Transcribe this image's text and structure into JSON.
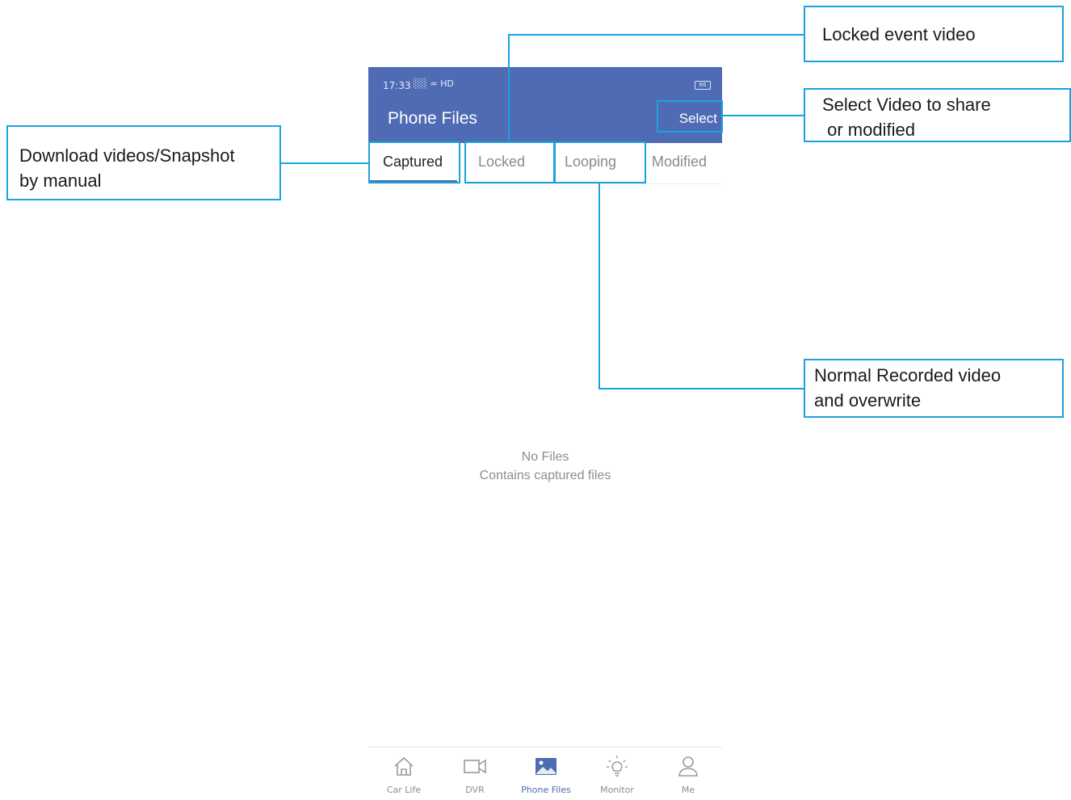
{
  "status_bar": {
    "time": "17:33",
    "icons": "░░ ≈ HD",
    "battery": "86"
  },
  "header": {
    "title": "Phone Files",
    "select_label": "Select"
  },
  "tabs": [
    {
      "label": "Captured",
      "active": true
    },
    {
      "label": "Locked",
      "active": false
    },
    {
      "label": "Looping",
      "active": false
    },
    {
      "label": "Modified",
      "active": false
    }
  ],
  "empty_state": {
    "title": "No Files",
    "subtitle": "Contains captured files"
  },
  "bottom_nav": [
    {
      "label": "Car Life",
      "icon": "home-icon",
      "active": false
    },
    {
      "label": "DVR",
      "icon": "video-camera-icon",
      "active": false
    },
    {
      "label": "Phone Files",
      "icon": "gallery-icon",
      "active": true
    },
    {
      "label": "Monitor",
      "icon": "light-bulb-icon",
      "active": false
    },
    {
      "label": "Me",
      "icon": "person-icon",
      "active": false
    }
  ],
  "annotations": {
    "captured": "Download videos/Snapshot\nby manual",
    "locked": "Locked event video",
    "select": "Select Video to share\n or modified",
    "looping": "Normal Recorded video\nand overwrite"
  },
  "colors": {
    "primary": "#4e6bb3",
    "annotation": "#1aa3df"
  }
}
